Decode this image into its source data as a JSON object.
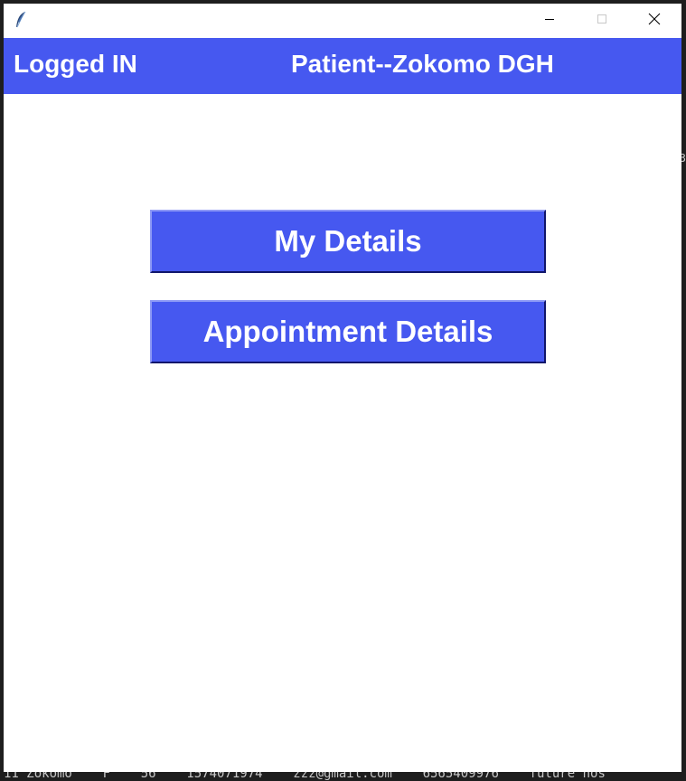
{
  "window": {
    "title": "",
    "controls": {
      "minimize": "minimize-icon",
      "maximize": "maximize-icon",
      "close": "close-icon"
    }
  },
  "header": {
    "status_text": "Logged IN",
    "patient_text": "Patient--Zokomo  DGH",
    "background_color": "#4658f0",
    "text_color": "#ffffff"
  },
  "main": {
    "buttons": [
      {
        "label": "My Details"
      },
      {
        "label": "Appointment Details"
      }
    ]
  },
  "background_terminal": {
    "bottom_line": "11 Zokomo    F    56    1574071974    zzz@gmail.com    6565409976    future hos",
    "edge_fragment": "3"
  }
}
